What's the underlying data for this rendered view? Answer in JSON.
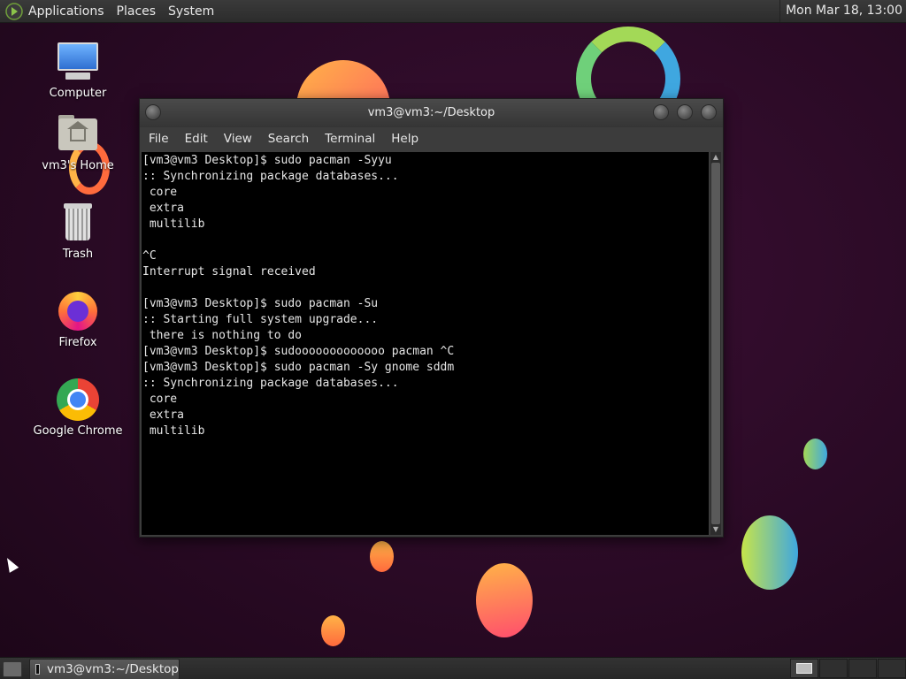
{
  "top_panel": {
    "menus": [
      "Applications",
      "Places",
      "System"
    ],
    "clock": "Mon Mar 18, 13:00"
  },
  "desktop_icons": [
    {
      "label": "Computer",
      "icon": "computer-icon"
    },
    {
      "label": "vm3's Home",
      "icon": "home-folder-icon"
    },
    {
      "label": "Trash",
      "icon": "trash-icon"
    },
    {
      "label": "Firefox",
      "icon": "firefox-icon"
    },
    {
      "label": "Google Chrome",
      "icon": "chrome-icon"
    }
  ],
  "terminal": {
    "title": "vm3@vm3:~/Desktop",
    "menu": [
      "File",
      "Edit",
      "View",
      "Search",
      "Terminal",
      "Help"
    ],
    "lines": [
      "[vm3@vm3 Desktop]$ sudo pacman -Syyu",
      ":: Synchronizing package databases...",
      " core",
      " extra",
      " multilib",
      "",
      "^C",
      "Interrupt signal received",
      "",
      "[vm3@vm3 Desktop]$ sudo pacman -Su",
      ":: Starting full system upgrade...",
      " there is nothing to do",
      "[vm3@vm3 Desktop]$ sudooooooooooooo pacman ^C",
      "[vm3@vm3 Desktop]$ sudo pacman -Sy gnome sddm",
      ":: Synchronizing package databases...",
      " core",
      " extra",
      " multilib"
    ]
  },
  "bottom_panel": {
    "task_label": "vm3@vm3:~/Desktop"
  },
  "colors": {
    "desktop_bg": "#2a0a25",
    "panel_bg": "#2c2c2c",
    "terminal_bg": "#000000",
    "terminal_fg": "#e6e6e6"
  }
}
